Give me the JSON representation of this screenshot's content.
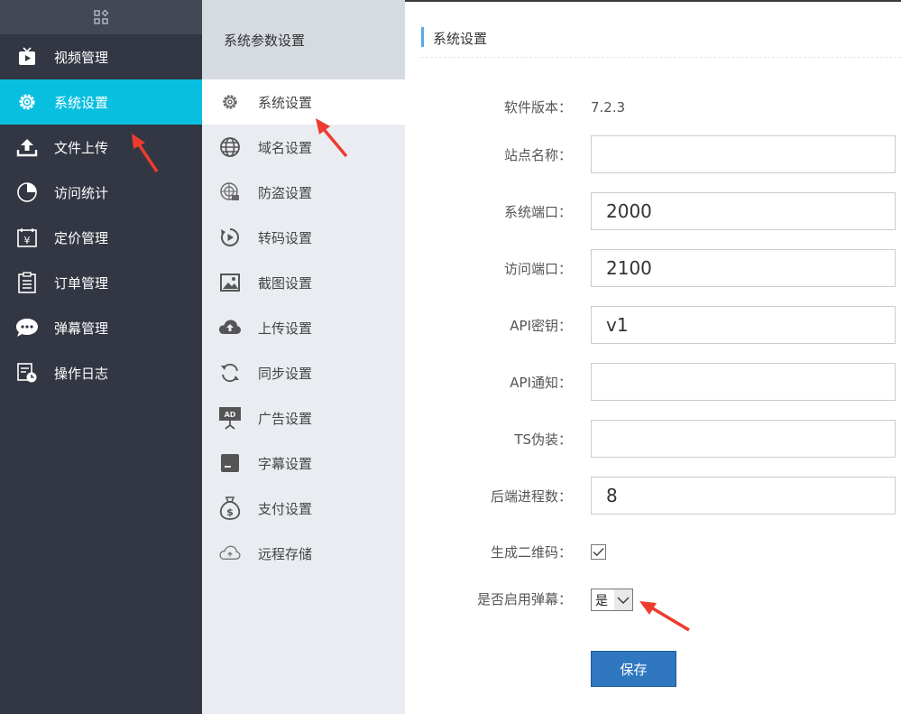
{
  "sidebar": {
    "items": [
      {
        "label": "视频管理",
        "icon": "tv-icon"
      },
      {
        "label": "系统设置",
        "icon": "gear-icon",
        "active": true
      },
      {
        "label": "文件上传",
        "icon": "upload-icon"
      },
      {
        "label": "访问统计",
        "icon": "pie-chart-icon"
      },
      {
        "label": "定价管理",
        "icon": "price-calendar-icon"
      },
      {
        "label": "订单管理",
        "icon": "clipboard-icon"
      },
      {
        "label": "弹幕管理",
        "icon": "chat-bubble-icon"
      },
      {
        "label": "操作日志",
        "icon": "log-clock-icon"
      }
    ]
  },
  "submenu": {
    "title": "系统参数设置",
    "items": [
      {
        "label": "系统设置",
        "icon": "gear-icon",
        "active": true
      },
      {
        "label": "域名设置",
        "icon": "globe-icon"
      },
      {
        "label": "防盗设置",
        "icon": "radar-lock-icon"
      },
      {
        "label": "转码设置",
        "icon": "play-refresh-icon"
      },
      {
        "label": "截图设置",
        "icon": "image-icon"
      },
      {
        "label": "上传设置",
        "icon": "cloud-upload-icon"
      },
      {
        "label": "同步设置",
        "icon": "sync-icon"
      },
      {
        "label": "广告设置",
        "icon": "ad-board-icon"
      },
      {
        "label": "字幕设置",
        "icon": "subtitle-icon"
      },
      {
        "label": "支付设置",
        "icon": "money-bag-icon"
      },
      {
        "label": "远程存储",
        "icon": "cloud-storage-icon"
      }
    ]
  },
  "main": {
    "title": "系统设置",
    "version_label": "软件版本：",
    "version_value": "7.2.3",
    "fields": [
      {
        "label": "站点名称：",
        "value": ""
      },
      {
        "label": "系统端口：",
        "value": "2000"
      },
      {
        "label": "访问端口：",
        "value": "2100"
      },
      {
        "label": "API密钥：",
        "value": "v1"
      },
      {
        "label": "API通知：",
        "value": ""
      },
      {
        "label": "TS伪装：",
        "value": ""
      },
      {
        "label": "后端进程数：",
        "value": "8"
      }
    ],
    "qrcode_label": "生成二维码：",
    "qrcode_checked": true,
    "danmu_label": "是否启用弹幕：",
    "danmu_value": "是",
    "save_label": "保存"
  },
  "colors": {
    "sidebar_bg": "#333743",
    "sidebar_active": "#09bfe0",
    "submenu_bg": "#e9ecf0",
    "save_button": "#2f78c0",
    "annotation_arrow": "#ee3b30"
  }
}
